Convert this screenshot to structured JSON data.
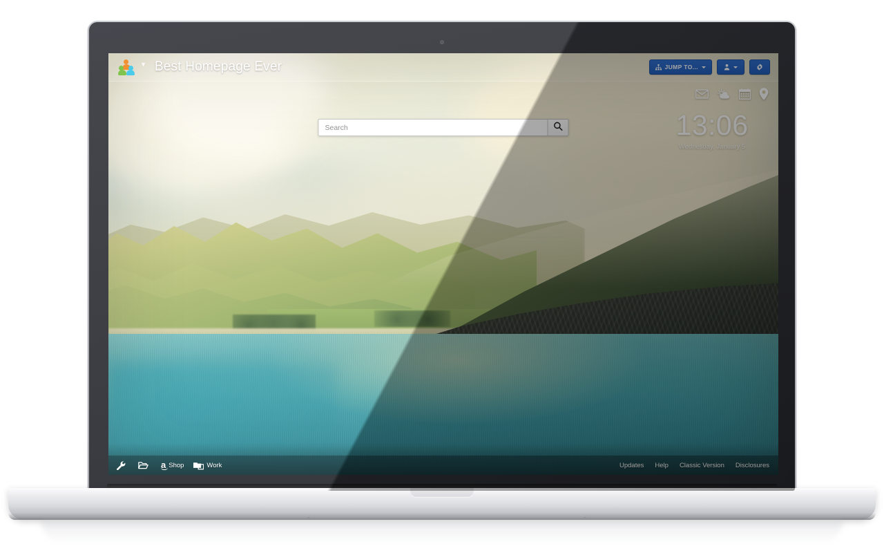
{
  "header": {
    "brand_title": "Best Homepage Ever",
    "logo_icon": "people-group-logo",
    "brand_caret_icon": "chevron-down-icon",
    "buttons": [
      {
        "label": "JUMP TO...",
        "icon": "sitemap-icon",
        "caret": true,
        "name": "jump-to-button"
      },
      {
        "label": "",
        "icon": "user-icon",
        "caret": true,
        "name": "user-menu-button"
      },
      {
        "label": "",
        "icon": "gear-icon",
        "caret": false,
        "name": "settings-button"
      }
    ]
  },
  "quick_icons": [
    {
      "name": "mail-icon",
      "label": "Mail"
    },
    {
      "name": "weather-icon",
      "label": "Weather"
    },
    {
      "name": "calendar-icon",
      "label": "Calendar"
    },
    {
      "name": "location-pin-icon",
      "label": "Location"
    }
  ],
  "clock": {
    "time": "13:06",
    "date": "Wednesday, January 5"
  },
  "search": {
    "value": "",
    "placeholder": "Search",
    "button_icon": "search-icon"
  },
  "footer": {
    "left_items": [
      {
        "label": "",
        "icon": "wrench-icon",
        "name": "tools-button"
      },
      {
        "label": "",
        "icon": "open-folder-icon",
        "name": "bookmarks-button"
      },
      {
        "label": "Shop",
        "icon": "amazon-a-icon",
        "name": "shop-folder"
      },
      {
        "label": "Work",
        "icon": "folders-icon",
        "name": "work-folder"
      }
    ],
    "right_links": [
      {
        "label": "Updates",
        "name": "updates-link"
      },
      {
        "label": "Help",
        "name": "help-link"
      },
      {
        "label": "Classic Version",
        "name": "classic-version-link"
      },
      {
        "label": "Disclosures",
        "name": "disclosures-link"
      }
    ]
  },
  "colors": {
    "button_blue": "#2360bd",
    "logo_orange": "#f08a25",
    "logo_green": "#79c143",
    "logo_cyan": "#3fc8e8",
    "footer_bar": "#122a2e"
  },
  "device": {
    "type": "laptop",
    "webcam_icon": "webcam-dot"
  }
}
